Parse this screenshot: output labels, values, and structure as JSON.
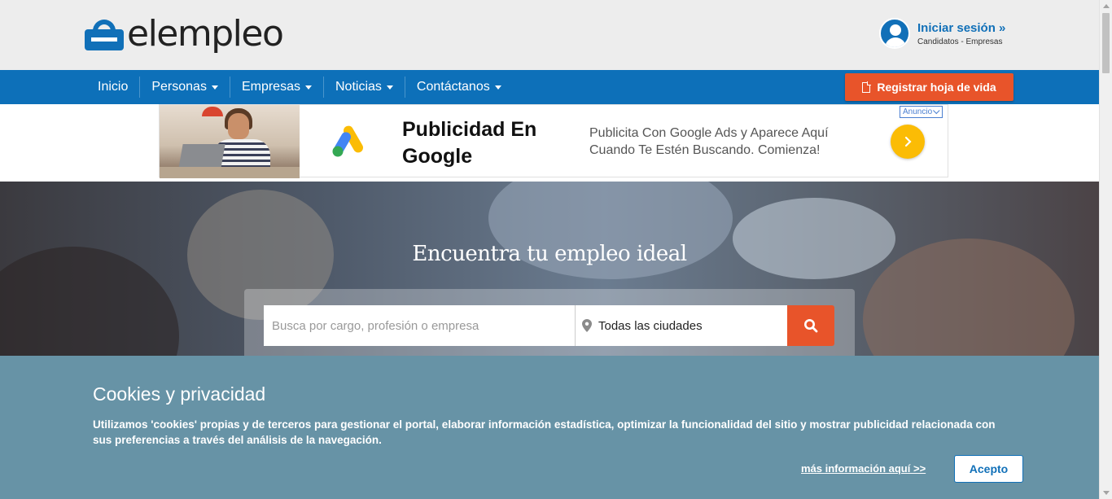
{
  "header": {
    "logo_text": "elempleo",
    "login_title": "Iniciar sesión »",
    "login_sub": "Candidatos - Empresas"
  },
  "nav": {
    "items": [
      {
        "label": "Inicio",
        "dropdown": false
      },
      {
        "label": "Personas",
        "dropdown": true
      },
      {
        "label": "Empresas",
        "dropdown": true
      },
      {
        "label": "Noticias",
        "dropdown": true
      },
      {
        "label": "Contáctanos",
        "dropdown": true
      }
    ],
    "register_label": "Registrar hoja de vida"
  },
  "ad": {
    "title": "Publicidad En Google",
    "description": "Publicita Con Google Ads y Aparece Aquí Cuando Te Estén Buscando. Comienza!",
    "badge": "Anuncio"
  },
  "hero": {
    "title": "Encuentra tu empleo ideal",
    "search_placeholder": "Busca por cargo, profesión o empresa",
    "city_value": "Todas las ciudades"
  },
  "cookie": {
    "title": "Cookies y privacidad",
    "text": "Utilizamos 'cookies' propias y de terceros para gestionar el portal, elaborar información estadística, optimizar la funcionalidad del sitio y mostrar publicidad relacionada con sus preferencias a través del análisis de la navegación.",
    "more_link": "más información aquí >>",
    "accept_label": "Acepto"
  },
  "colors": {
    "brand_blue": "#1170b8",
    "nav_blue": "#0d70b9",
    "accent_orange": "#e8542a",
    "cookie_bg": "#6793a6"
  }
}
